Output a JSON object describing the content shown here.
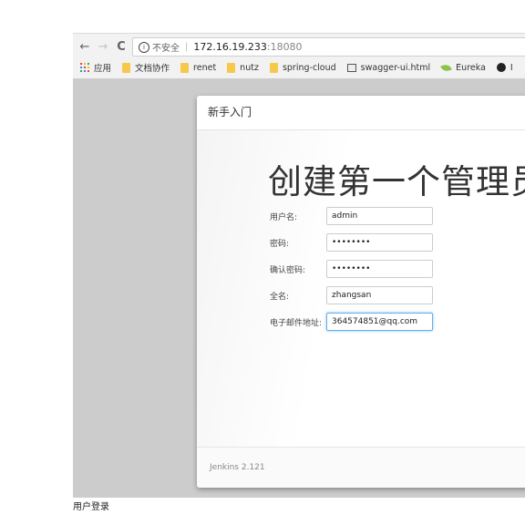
{
  "browser": {
    "back_icon": "←",
    "forward_icon": "→",
    "reload_icon": "C",
    "info_icon": "i",
    "security_label": "不安全",
    "url_host": "172.16.19.233",
    "url_port": ":18080"
  },
  "bookmarks": [
    {
      "label": "应用",
      "icon": "apps-grid-icon"
    },
    {
      "label": "文档协作",
      "icon": "folder-icon"
    },
    {
      "label": "renet",
      "icon": "folder-icon"
    },
    {
      "label": "nutz",
      "icon": "folder-icon"
    },
    {
      "label": "spring-cloud",
      "icon": "folder-icon"
    },
    {
      "label": "swagger-ui.html",
      "icon": "image-icon"
    },
    {
      "label": "Eureka",
      "icon": "leaf-icon"
    },
    {
      "label": "I",
      "icon": "github-icon"
    }
  ],
  "dialog": {
    "header": "新手入门",
    "title": "创建第一个管理员用户",
    "footer_version": "Jenkins 2.121"
  },
  "form": {
    "username": {
      "label": "用户名:",
      "value": "admin"
    },
    "password": {
      "label": "密码:",
      "value": "••••••••"
    },
    "confirm_password": {
      "label": "确认密码:",
      "value": "••••••••"
    },
    "fullname": {
      "label": "全名:",
      "value": "zhangsan"
    },
    "email": {
      "label": "电子邮件地址:",
      "value": "364574851@qq.com"
    }
  },
  "caption": "用户登录"
}
